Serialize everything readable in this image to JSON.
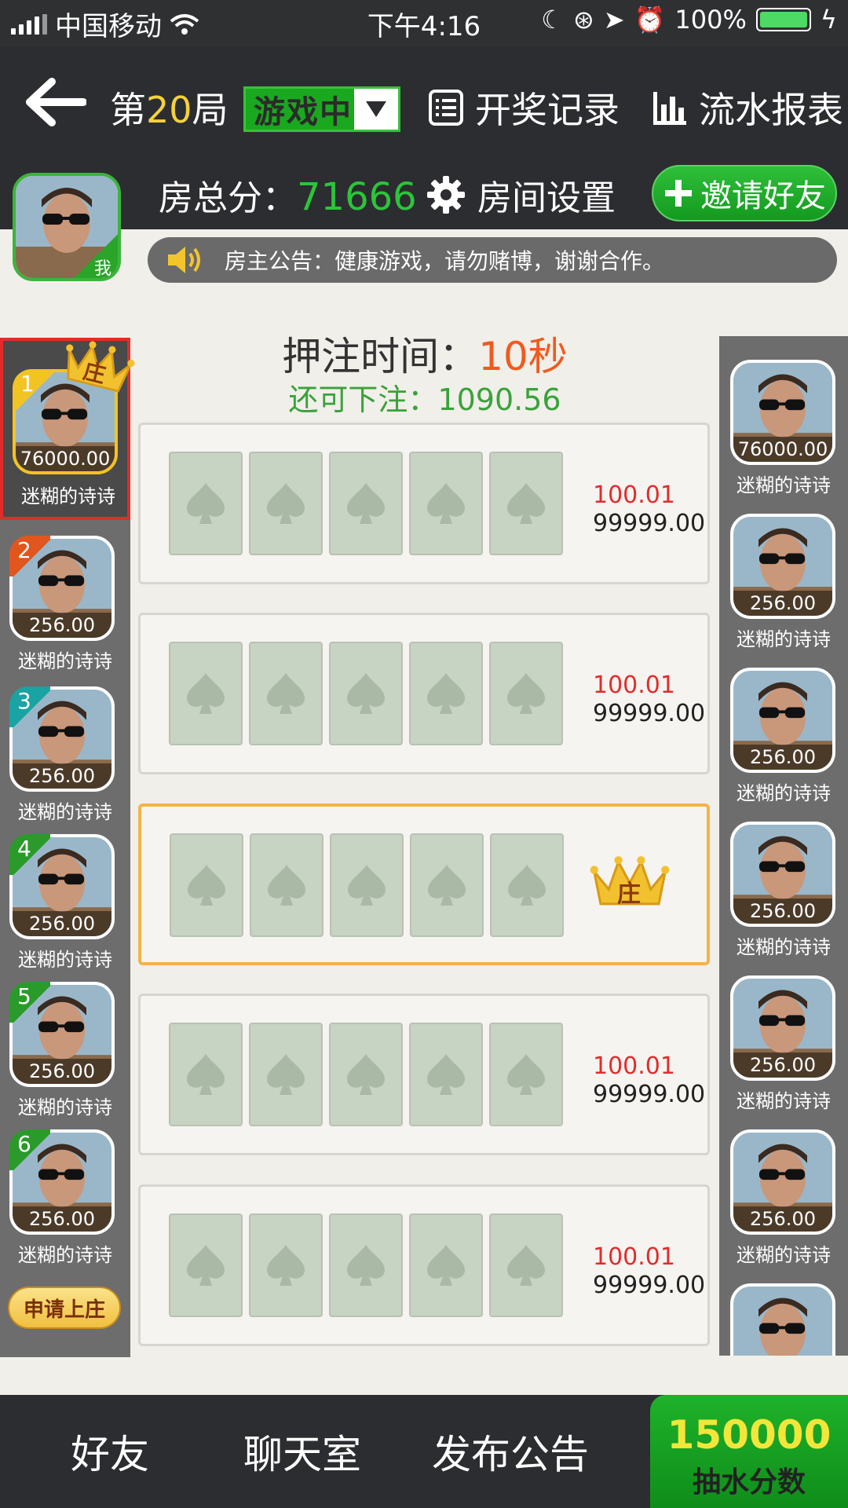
{
  "status_bar": {
    "carrier": "中国移动",
    "time": "下午4:16",
    "battery": "100%"
  },
  "header": {
    "round_prefix": "第",
    "round_number": "20",
    "round_suffix": "局",
    "status_label": "游戏中",
    "records_label": "开奖记录",
    "report_label": "流水报表"
  },
  "room": {
    "score_label": "房总分：",
    "score_value": "71666",
    "settings_label": "房间设置",
    "invite_label": "邀请好友",
    "me_tag": "我"
  },
  "notice": {
    "text": "房主公告：健康游戏，请勿赌博，谢谢合作。"
  },
  "betting": {
    "time_label": "押注时间：",
    "time_value": "10秒",
    "remain_label": "还可下注：",
    "remain_value": "1090.56"
  },
  "bet_rows": [
    {
      "a": "100.01",
      "b": "99999.00"
    },
    {
      "a": "100.01",
      "b": "99999.00"
    },
    {
      "banker": true,
      "crown_text": "庄"
    },
    {
      "a": "100.01",
      "b": "99999.00"
    },
    {
      "a": "100.01",
      "b": "99999.00"
    }
  ],
  "left_players": [
    {
      "rank": "1",
      "score": "76000.00",
      "name": "迷糊的诗诗",
      "crown": "庄",
      "badge_color": "#f2c423"
    },
    {
      "rank": "2",
      "score": "256.00",
      "name": "迷糊的诗诗",
      "badge_color": "#e0561e"
    },
    {
      "rank": "3",
      "score": "256.00",
      "name": "迷糊的诗诗",
      "badge_color": "#1aa3a3"
    },
    {
      "rank": "4",
      "score": "256.00",
      "name": "迷糊的诗诗",
      "badge_color": "#2a9a2a"
    },
    {
      "rank": "5",
      "score": "256.00",
      "name": "迷糊的诗诗",
      "badge_color": "#2a9a2a"
    },
    {
      "rank": "6",
      "score": "256.00",
      "name": "迷糊的诗诗",
      "badge_color": "#2a9a2a"
    }
  ],
  "apply_banker_label": "申请上庄",
  "right_players": [
    {
      "score": "76000.00",
      "name": "迷糊的诗诗"
    },
    {
      "score": "256.00",
      "name": "迷糊的诗诗"
    },
    {
      "score": "256.00",
      "name": "迷糊的诗诗"
    },
    {
      "score": "256.00",
      "name": "迷糊的诗诗"
    },
    {
      "score": "256.00",
      "name": "迷糊的诗诗"
    },
    {
      "score": "256.00",
      "name": "迷糊的诗诗"
    },
    {
      "score": "",
      "name": ""
    }
  ],
  "bottom": {
    "friends": "好友",
    "chat": "聊天室",
    "publish": "发布公告",
    "fee_value": "150000",
    "fee_label": "抽水分数"
  }
}
